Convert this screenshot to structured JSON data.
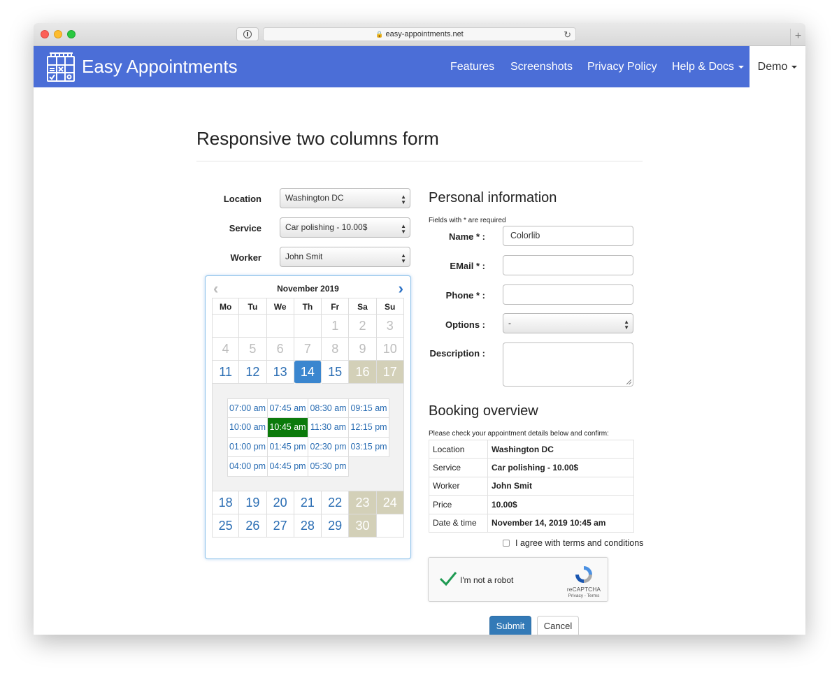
{
  "browser": {
    "url": "easy-appointments.net",
    "newtab_label": "+"
  },
  "navbar": {
    "brand": "Easy Appointments",
    "items": [
      {
        "label": "Features"
      },
      {
        "label": "Screenshots"
      },
      {
        "label": "Privacy Policy"
      },
      {
        "label": "Help & Docs"
      },
      {
        "label": "Demo"
      }
    ],
    "color": "#4b6ed7"
  },
  "page": {
    "title": "Responsive two columns form"
  },
  "left_form": {
    "location": {
      "label": "Location",
      "value": "Washington DC"
    },
    "service": {
      "label": "Service",
      "value": "Car polishing - 10.00$"
    },
    "worker": {
      "label": "Worker",
      "value": "John Smit"
    }
  },
  "calendar": {
    "month": "November 2019",
    "weekdays": [
      "Mo",
      "Tu",
      "We",
      "Th",
      "Fr",
      "Sa",
      "Su"
    ],
    "weeks_before": [
      [
        "",
        "",
        "",
        "",
        "1",
        "2",
        "3"
      ],
      [
        "4",
        "5",
        "6",
        "7",
        "8",
        "9",
        "10"
      ],
      [
        "11",
        "12",
        "13",
        "14",
        "15",
        "16",
        "17"
      ]
    ],
    "weeks_after": [
      [
        "18",
        "19",
        "20",
        "21",
        "22",
        "23",
        "24"
      ],
      [
        "25",
        "26",
        "27",
        "28",
        "29",
        "30",
        ""
      ]
    ],
    "selected_day": "14",
    "times": [
      [
        "07:00 am",
        "07:45 am",
        "08:30 am",
        "09:15 am"
      ],
      [
        "10:00 am",
        "10:45 am",
        "11:30 am",
        "12:15 pm"
      ],
      [
        "01:00 pm",
        "01:45 pm",
        "02:30 pm",
        "03:15 pm"
      ],
      [
        "04:00 pm",
        "04:45 pm",
        "05:30 pm",
        ""
      ]
    ],
    "selected_time": "10:45 am"
  },
  "personal": {
    "heading": "Personal information",
    "required_note": "Fields with * are required",
    "name": {
      "label": "Name * :",
      "value": "Colorlib"
    },
    "email": {
      "label": "EMail * :",
      "value": ""
    },
    "phone": {
      "label": "Phone * :",
      "value": ""
    },
    "options": {
      "label": "Options :",
      "value": "-"
    },
    "description": {
      "label": "Description :",
      "value": ""
    }
  },
  "overview": {
    "heading": "Booking overview",
    "note": "Please check your appointment details below and confirm:",
    "rows": [
      {
        "key": "Location",
        "value": "Washington DC"
      },
      {
        "key": "Service",
        "value": "Car polishing - 10.00$"
      },
      {
        "key": "Worker",
        "value": "John Smit"
      },
      {
        "key": "Price",
        "value": "10.00$"
      },
      {
        "key": "Date & time",
        "value": "November 14, 2019 10:45 am"
      }
    ]
  },
  "agree_label": "I agree with terms and conditions",
  "recaptcha": {
    "label": "I'm not a robot",
    "brand": "reCAPTCHA",
    "terms": "Privacy - Terms"
  },
  "buttons": {
    "submit": "Submit",
    "cancel": "Cancel"
  }
}
